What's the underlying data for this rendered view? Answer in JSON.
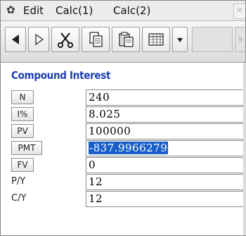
{
  "menubar": {
    "items": [
      "Edit",
      "Calc(1)",
      "Calc(2)"
    ]
  },
  "toolbar": {
    "buttons": [
      "back-arrow",
      "forward-arrow",
      "cut",
      "copy",
      "paste",
      "matrix",
      "dropdown"
    ]
  },
  "form": {
    "title": "Compound Interest",
    "rows": [
      {
        "label": "N",
        "value": "240",
        "selected": false
      },
      {
        "label": "I%",
        "value": "8.025",
        "selected": false
      },
      {
        "label": "PV",
        "value": "100000",
        "selected": false
      },
      {
        "label": "PMT",
        "value": "-837.9966279",
        "selected": true
      },
      {
        "label": "FV",
        "value": "0",
        "selected": false
      },
      {
        "label": "P/Y",
        "value": "12",
        "selected": false
      },
      {
        "label": "C/Y",
        "value": "12",
        "selected": false
      }
    ]
  }
}
